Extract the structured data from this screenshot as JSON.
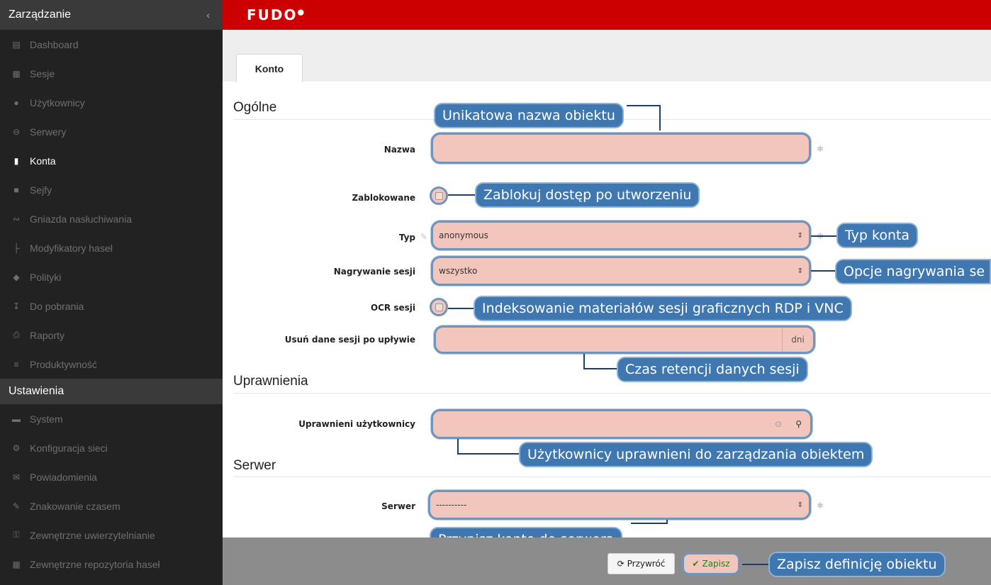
{
  "sidebar": {
    "management_title": "Zarządzanie",
    "collapse_icon": "chevron-left-icon",
    "items": [
      {
        "label": "Dashboard",
        "icon": "chart-icon"
      },
      {
        "label": "Sesje",
        "icon": "film-icon"
      },
      {
        "label": "Użytkownicy",
        "icon": "users-icon"
      },
      {
        "label": "Serwery",
        "icon": "server-icon"
      },
      {
        "label": "Konta",
        "icon": "card-icon",
        "active": true
      },
      {
        "label": "Sejfy",
        "icon": "safe-icon"
      },
      {
        "label": "Gniazda nasłuchiwania",
        "icon": "rss-icon"
      },
      {
        "label": "Modyfikatory haseł",
        "icon": "sitemap-icon"
      },
      {
        "label": "Polityki",
        "icon": "shield-icon"
      },
      {
        "label": "Do pobrania",
        "icon": "download-icon"
      },
      {
        "label": "Raporty",
        "icon": "print-icon"
      },
      {
        "label": "Produktywność",
        "icon": "list-icon"
      }
    ],
    "settings_title": "Ustawienia",
    "settings_items": [
      {
        "label": "System",
        "icon": "folder-icon"
      },
      {
        "label": "Konfiguracja sieci",
        "icon": "cogs-icon"
      },
      {
        "label": "Powiadomienia",
        "icon": "envelope-icon"
      },
      {
        "label": "Znakowanie czasem",
        "icon": "edit-icon"
      },
      {
        "label": "Zewnętrzne uwierzytelnianie",
        "icon": "key-icon"
      },
      {
        "label": "Zewnętrzne repozytoria haseł",
        "icon": "grid-icon"
      }
    ]
  },
  "header": {
    "logo": "FUDO",
    "accent_color": "#cc0000"
  },
  "tabs": [
    {
      "label": "Konto"
    }
  ],
  "form": {
    "section_general": "Ogólne",
    "section_permissions": "Uprawnienia",
    "section_server": "Serwer",
    "labels": {
      "name": "Nazwa",
      "blocked": "Zablokowane",
      "type": "Typ",
      "recording": "Nagrywanie sesji",
      "ocr": "OCR sesji",
      "retention": "Usuń dane sesji po upływie",
      "users": "Uprawnieni użytkownicy",
      "server": "Serwer"
    },
    "values": {
      "name": "",
      "type": "anonymous",
      "recording": "wszystko",
      "retention": "",
      "retention_unit": "dni",
      "server": "----------"
    }
  },
  "callouts": {
    "name": "Unikatowa nazwa obiektu",
    "blocked": "Zablokuj dostęp po utworzeniu",
    "type": "Typ konta",
    "recording": "Opcje nagrywania se",
    "ocr": "Indeksowanie materiałów sesji graficznych RDP i VNC",
    "retention": "Czas retencji danych sesji",
    "users": "Użytkownicy uprawnieni do zarządzania obiektem",
    "server": "Przypisz konto do serwera",
    "save": "Zapisz definicję obiektu"
  },
  "footer": {
    "revert_label": "Przywróć",
    "save_label": "Zapisz",
    "revert_icon": "refresh-icon",
    "save_icon": "check-icon"
  },
  "colors": {
    "sidebar_bg": "#222222",
    "highlight_fill": "#f2c6bc",
    "highlight_border": "#6f95bd",
    "callout_bg": "#3f78b0",
    "footer_bg": "#8c8c8c"
  }
}
